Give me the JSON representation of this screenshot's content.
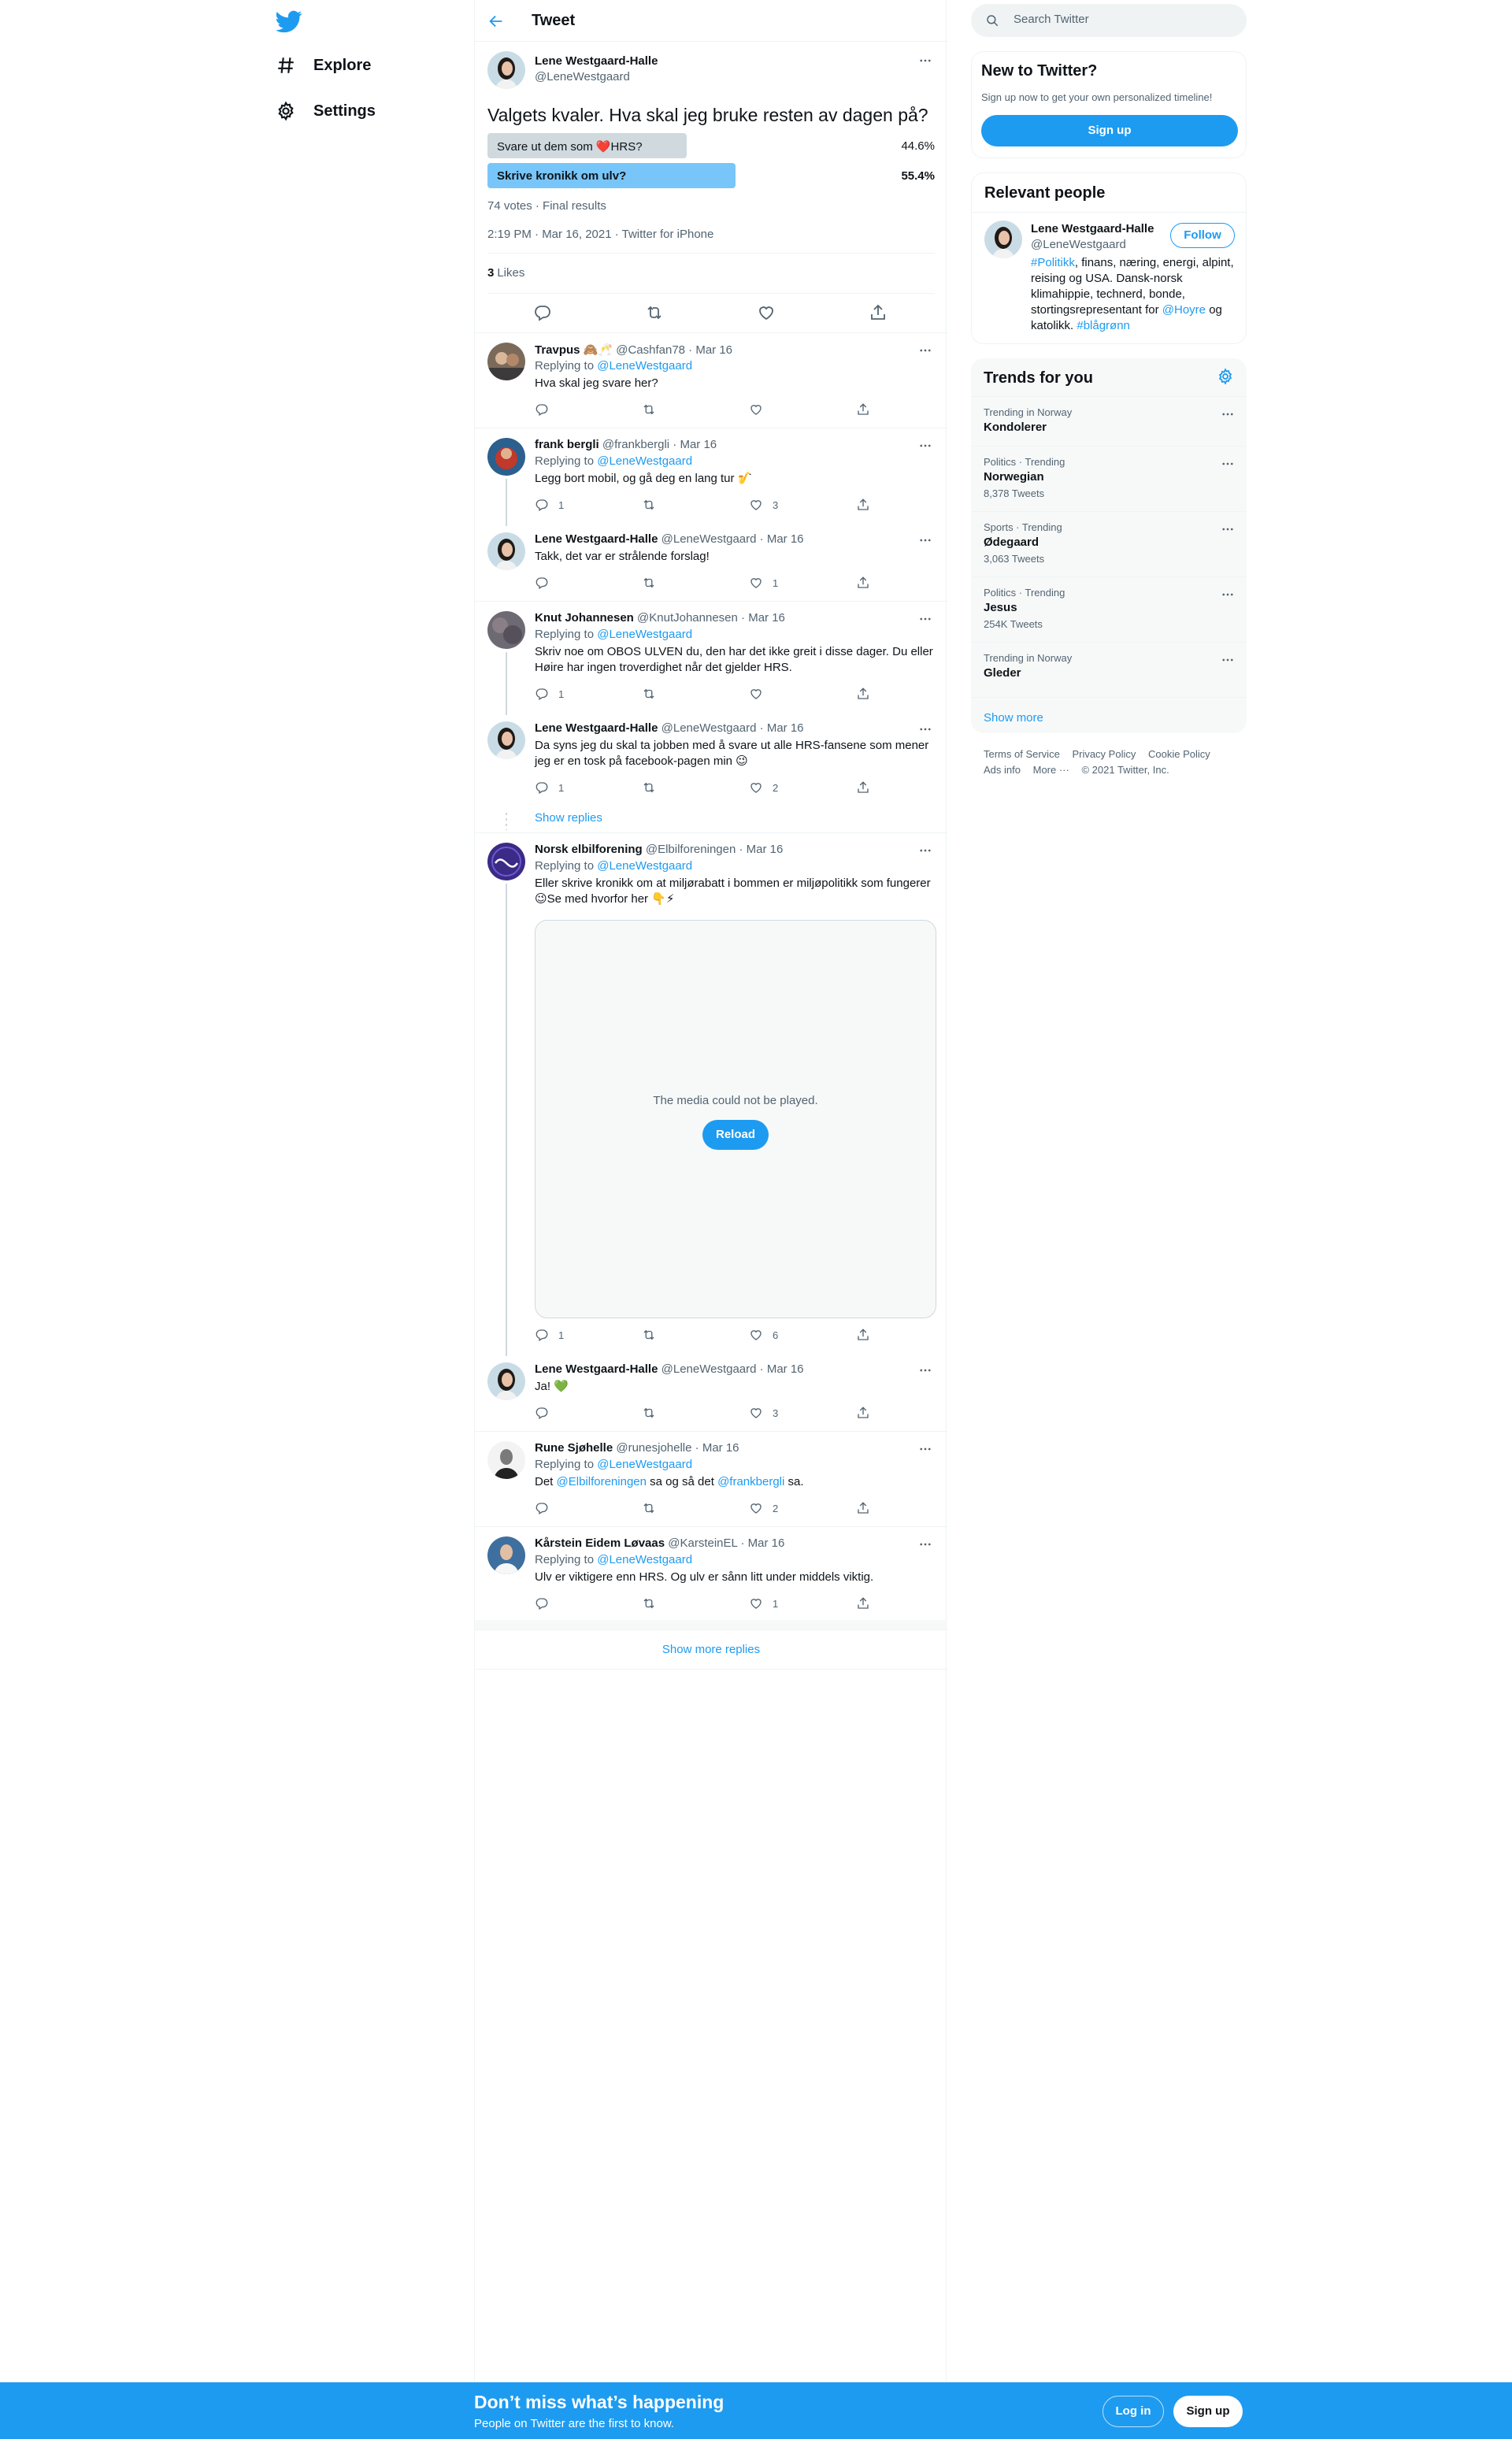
{
  "colors": {
    "accent": "#1d9bf0",
    "text": "#0f1419",
    "muted": "#536471",
    "poll_winner": "#78c6f9",
    "poll_loser": "#cfd9de"
  },
  "nav": {
    "logo": "twitter-bird-icon",
    "items": [
      {
        "label": "Explore",
        "icon": "hashtag-icon"
      },
      {
        "label": "Settings",
        "icon": "gear-icon"
      }
    ]
  },
  "header": {
    "title": "Tweet"
  },
  "focal": {
    "name": "Lene Westgaard-Halle",
    "handle": "@LeneWestgaard",
    "text": "Valgets kvaler. Hva skal jeg bruke resten av dagen på?",
    "poll": [
      {
        "label": "Svare ut dem som ❤️HRS?",
        "pct_text": "44.6%",
        "pct": 44.6,
        "winner": false
      },
      {
        "label": "Skrive kronikk om ulv?",
        "pct_text": "55.4%",
        "pct": 55.4,
        "winner": true
      }
    ],
    "poll_meta": "74 votes · Final results",
    "time": "2:19 PM · Mar 16, 2021 · Twitter for iPhone",
    "likes_count": "3",
    "likes_label": "Likes"
  },
  "replies": [
    {
      "name": "Travpus 🙈🥂",
      "handle": "@Cashfan78",
      "date": "Mar 16",
      "replying_prefix": "Replying to",
      "replying_to": "@LeneWestgaard",
      "text": "Hva skal jeg svare her?",
      "reply_count": "",
      "like_count": ""
    },
    {
      "name": "frank bergli",
      "handle": "@frankbergli",
      "date": "Mar 16",
      "replying_prefix": "Replying to",
      "replying_to": "@LeneWestgaard",
      "text": "Legg bort mobil, og gå deg en lang tur 🎷",
      "reply_count": "1",
      "like_count": "3"
    },
    {
      "name": "Lene Westgaard-Halle",
      "handle": "@LeneWestgaard",
      "date": "Mar 16",
      "text": "Takk, det var er strålende forslag!",
      "reply_count": "",
      "like_count": "1"
    },
    {
      "name": "Knut Johannesen",
      "handle": "@KnutJohannesen",
      "date": "Mar 16",
      "replying_prefix": "Replying to",
      "replying_to": "@LeneWestgaard",
      "text": "Skriv noe om OBOS ULVEN du, den har det ikke greit i disse dager. Du eller Høire har ingen troverdighet når det gjelder HRS.",
      "reply_count": "1",
      "like_count": ""
    },
    {
      "name": "Lene Westgaard-Halle",
      "handle": "@LeneWestgaard",
      "date": "Mar 16",
      "text": "Da syns jeg du skal ta jobben med å svare ut alle HRS-fansene som mener jeg er en tosk på facebook-pagen min 😉",
      "reply_count": "1",
      "like_count": "2"
    },
    {
      "name": "Norsk elbilforening",
      "handle": "@Elbilforeningen",
      "date": "Mar 16",
      "replying_prefix": "Replying to",
      "replying_to": "@LeneWestgaard",
      "text": "Eller skrive kronikk om at miljørabatt i bommen er miljøpolitikk som fungerer 😉Se med hvorfor her 👇⚡",
      "reply_count": "1",
      "like_count": "6"
    },
    {
      "name": "Lene Westgaard-Halle",
      "handle": "@LeneWestgaard",
      "date": "Mar 16",
      "text": "Ja! 💚",
      "reply_count": "",
      "like_count": "3"
    },
    {
      "name": "Rune Sjøhelle",
      "handle": "@runesjohelle",
      "date": "Mar 16",
      "replying_prefix": "Replying to",
      "replying_to": "@LeneWestgaard",
      "text_pre": "Det",
      "mention1": "@Elbilforeningen",
      "text_mid": "sa og så det",
      "mention2": "@frankbergli",
      "text_post": "sa.",
      "reply_count": "",
      "like_count": "2"
    },
    {
      "name": "Kårstein Eidem Løvaas",
      "handle": "@KarsteinEL",
      "date": "Mar 16",
      "replying_prefix": "Replying to",
      "replying_to": "@LeneWestgaard",
      "text": "Ulv er viktigere enn HRS. Og ulv er sånn litt under middels viktig.",
      "reply_count": "",
      "like_count": "1"
    }
  ],
  "show_replies": "Show replies",
  "media": {
    "message": "The media could not be played.",
    "reload": "Reload"
  },
  "show_more_replies": "Show more replies",
  "search": {
    "placeholder": "Search Twitter"
  },
  "new_to_twitter": {
    "title": "New to Twitter?",
    "subtitle": "Sign up now to get your own personalized timeline!",
    "button": "Sign up"
  },
  "relevant": {
    "title": "Relevant people",
    "name": "Lene Westgaard-Halle",
    "handle": "@LeneWestgaard",
    "follow": "Follow",
    "bio_tag1": "#Politikk",
    "bio_mid": ", finans, næring, energi, alpint, reising og USA. Dansk-norsk klimahippie, technerd, bonde, stortingsrepresentant for",
    "bio_mention": "@Hoyre",
    "bio_og": "og katolikk.",
    "bio_tag2": "#blågrønn"
  },
  "trends": {
    "title": "Trends for you",
    "items": [
      {
        "meta": "Trending in Norway",
        "name": "Kondolerer",
        "count": ""
      },
      {
        "meta": "Politics · Trending",
        "name": "Norwegian",
        "count": "8,378 Tweets"
      },
      {
        "meta": "Sports · Trending",
        "name": "Ødegaard",
        "count": "3,063 Tweets"
      },
      {
        "meta": "Politics · Trending",
        "name": "Jesus",
        "count": "254K Tweets"
      },
      {
        "meta": "Trending in Norway",
        "name": "Gleder",
        "count": ""
      }
    ],
    "show_more": "Show more"
  },
  "footer": {
    "links": [
      "Terms of Service",
      "Privacy Policy",
      "Cookie Policy",
      "Ads info",
      "More ···",
      "© 2021 Twitter, Inc."
    ]
  },
  "banner": {
    "title": "Don’t miss what’s happening",
    "subtitle": "People on Twitter are the first to know.",
    "login": "Log in",
    "signup": "Sign up"
  }
}
